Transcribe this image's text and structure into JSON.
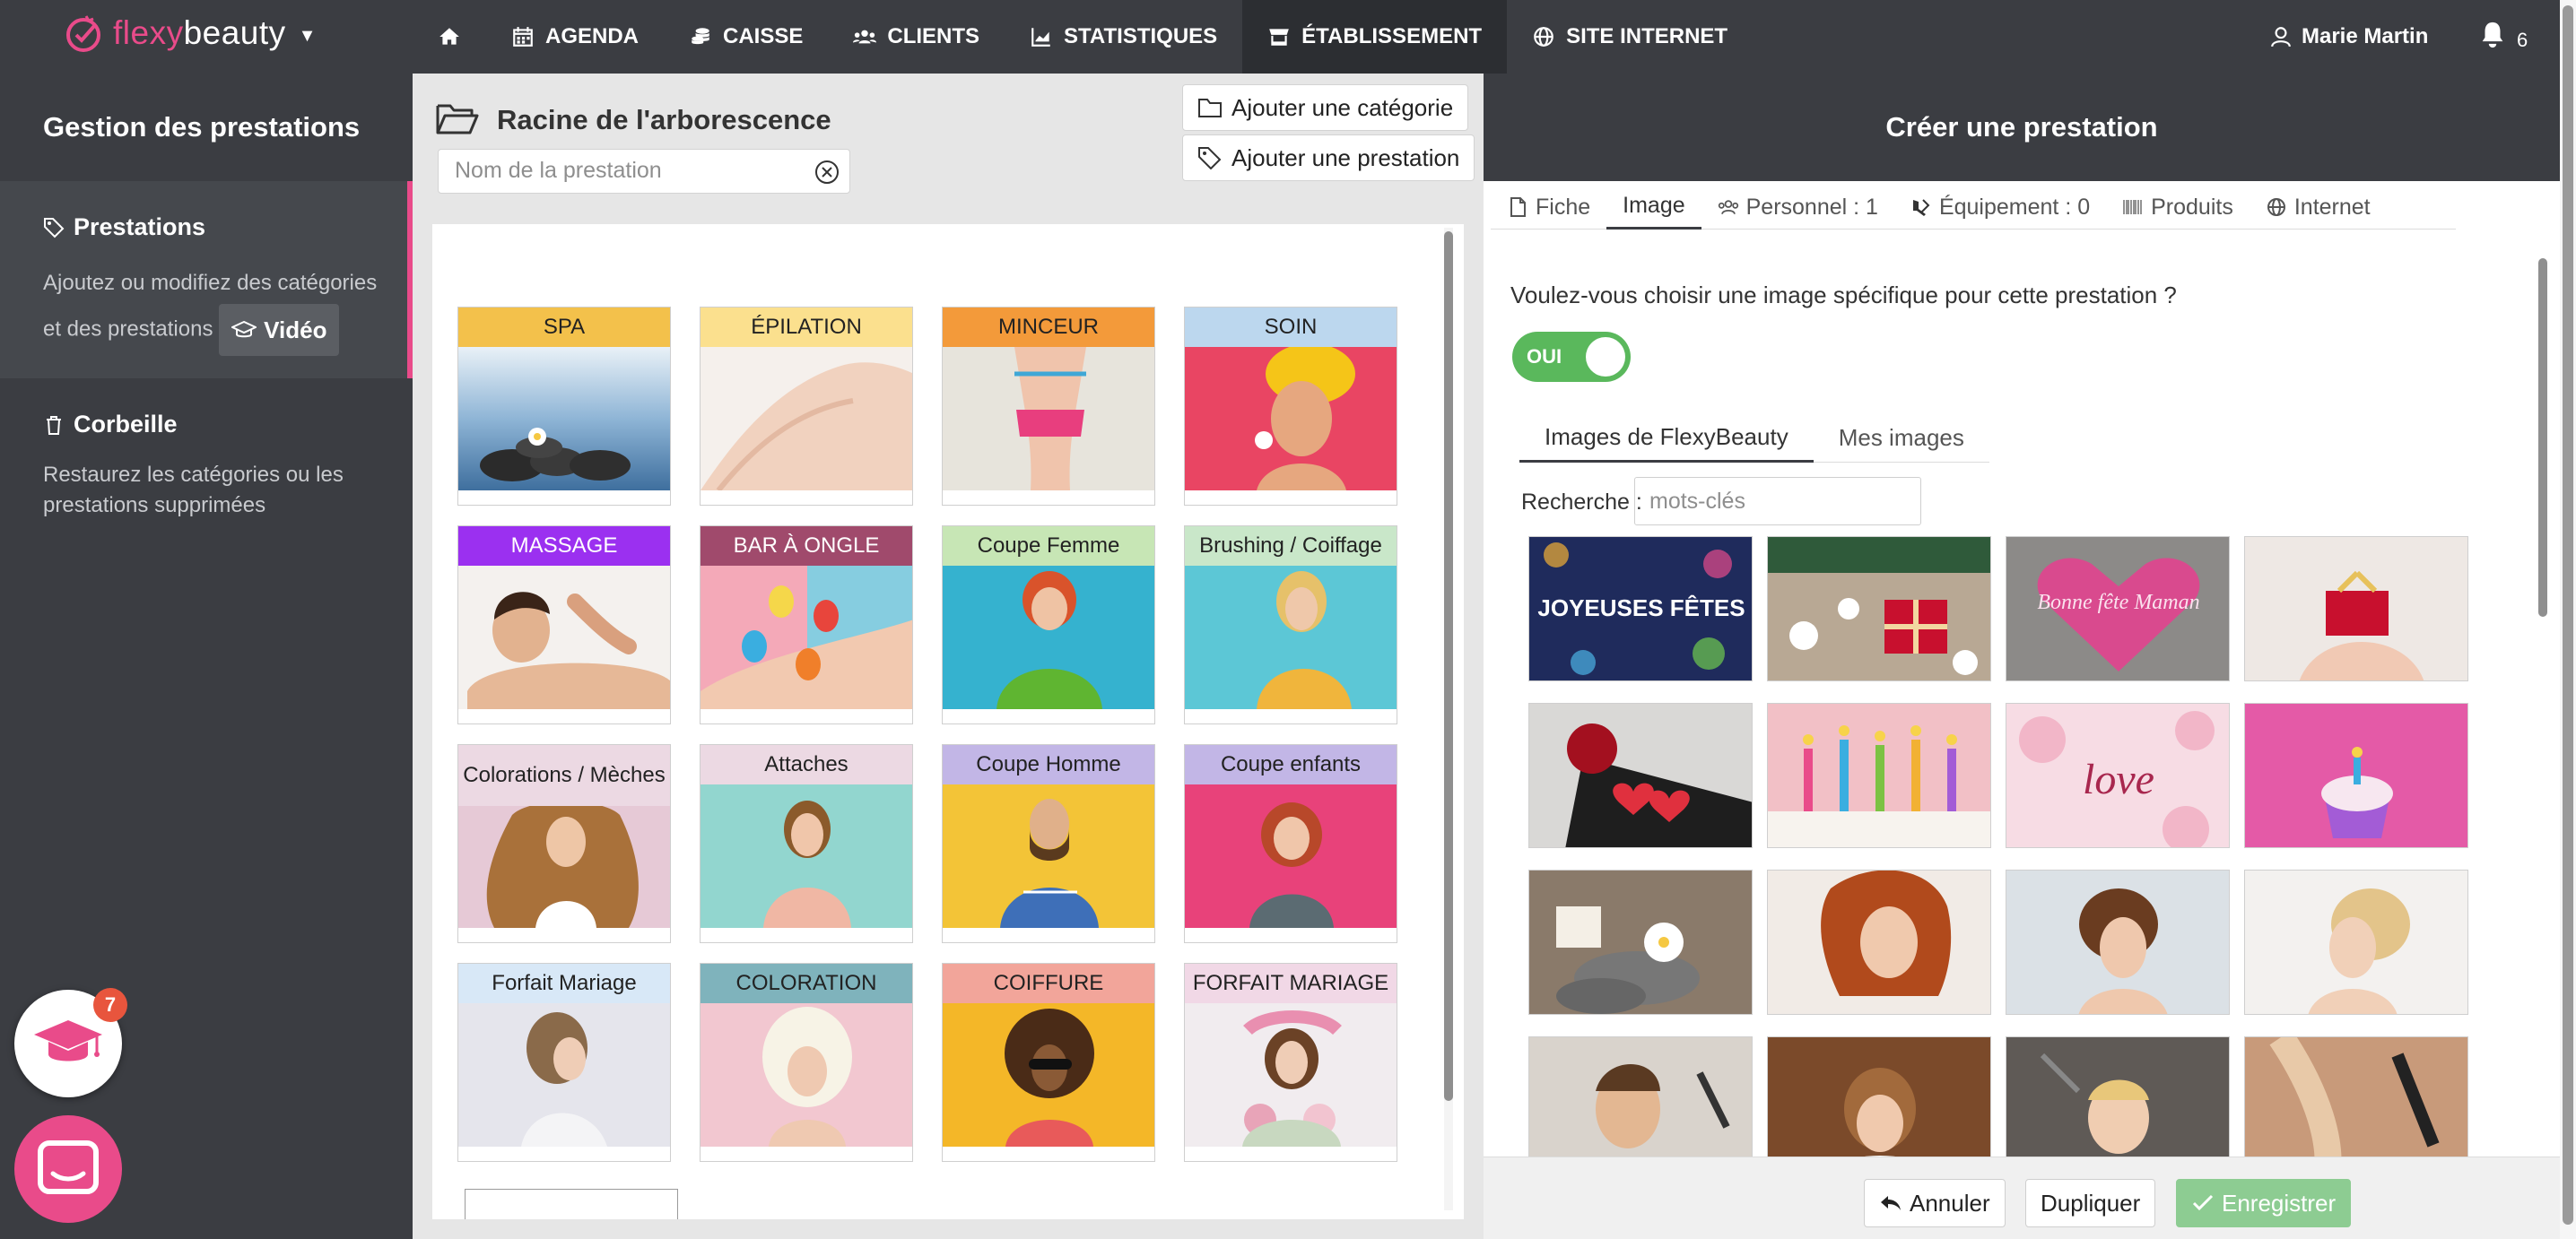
{
  "brand": {
    "name_part1": "flexy",
    "name_part2": "beauty",
    "accent": "#e94b8a"
  },
  "nav": {
    "items": [
      {
        "icon": "home-icon",
        "label": ""
      },
      {
        "icon": "calendar-icon",
        "label": "AGENDA"
      },
      {
        "icon": "coins-icon",
        "label": "CAISSE"
      },
      {
        "icon": "users-icon",
        "label": "CLIENTS"
      },
      {
        "icon": "chart-icon",
        "label": "STATISTIQUES"
      },
      {
        "icon": "store-icon",
        "label": "ÉTABLISSEMENT",
        "active": true
      },
      {
        "icon": "globe-icon",
        "label": "SITE INTERNET"
      }
    ],
    "user_name": "Marie Martin",
    "notifications": "6"
  },
  "sidebar": {
    "title": "Gestion des prestations",
    "prestations": {
      "label": "Prestations",
      "desc": "Ajoutez ou modifiez des catégories et des prestations",
      "video_label": "Vidéo"
    },
    "corbeille": {
      "label": "Corbeille",
      "desc": "Restaurez les catégories ou les prestations supprimées"
    },
    "academy_badge": "7"
  },
  "middle": {
    "title": "Racine de l'arborescence",
    "search_placeholder": "Nom de la prestation",
    "add_category": "Ajouter une catégorie",
    "add_service": "Ajouter une prestation",
    "categories": [
      {
        "label": "SPA",
        "color": "#f3c14b"
      },
      {
        "label": "ÉPILATION",
        "color": "#fbe08e"
      },
      {
        "label": "MINCEUR",
        "color": "#f39a3a"
      },
      {
        "label": "SOIN",
        "color": "#bcd7ee"
      },
      {
        "label": "MASSAGE",
        "color": "#9b30f0",
        "light": true
      },
      {
        "label": "BAR À ONGLE",
        "color": "#a04a6c",
        "light": true
      },
      {
        "label": "Coupe Femme",
        "color": "#c7e6b5"
      },
      {
        "label": "Brushing / Coiffage",
        "color": "#c9e7c9"
      },
      {
        "label": "Colorations / Mèches",
        "color": "#ecd9e3"
      },
      {
        "label": "Attaches",
        "color": "#ecd9e3"
      },
      {
        "label": "Coupe Homme",
        "color": "#c2b6e6"
      },
      {
        "label": "Coupe enfants",
        "color": "#c2b6e6"
      },
      {
        "label": "Forfait Mariage",
        "color": "#d8e8f7"
      },
      {
        "label": "COLORATION",
        "color": "#7fb3bc"
      },
      {
        "label": "COIFFURE",
        "color": "#f2a59a"
      },
      {
        "label": "FORFAIT MARIAGE",
        "color": "#f1d8e6"
      }
    ]
  },
  "panel": {
    "title": "Créer une prestation",
    "tabs": [
      {
        "icon": "file-icon",
        "label": "Fiche"
      },
      {
        "icon": "",
        "label": "Image",
        "active": true
      },
      {
        "icon": "staff-icon",
        "label": "Personnel : 1"
      },
      {
        "icon": "equipment-icon",
        "label": "Équipement : 0"
      },
      {
        "icon": "barcode-icon",
        "label": "Produits"
      },
      {
        "icon": "globe-icon",
        "label": "Internet"
      }
    ],
    "question": "Voulez-vous choisir une image spécifique pour cette prestation ?",
    "toggle_label": "OUI",
    "subtabs": [
      "Images de FlexyBeauty",
      "Mes images"
    ],
    "search_label": "Recherche :",
    "search_placeholder": "mots-clés",
    "thumb_1_text": "JOYEUSES FÊTES",
    "thumb_3_text": "Bonne fête Maman",
    "thumb_7_text": "love",
    "buttons": {
      "cancel": "Annuler",
      "duplicate": "Dupliquer",
      "save": "Enregistrer"
    }
  }
}
